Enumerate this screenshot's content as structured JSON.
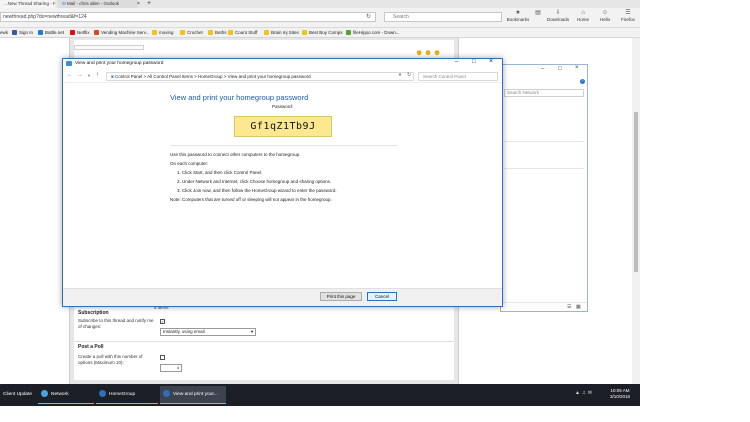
{
  "browser": {
    "tabs": [
      {
        "label": "...New Thread Sharing - Po..."
      },
      {
        "label": "Mail - chris allen - Outlook"
      }
    ],
    "new_tab_glyph": "+",
    "url": "newthread.php?do=newthread&f=124",
    "search_placeholder": "Search",
    "toolbar": [
      {
        "label": "Bookmarks",
        "icon": "star-icon"
      },
      {
        "label": "Downloads",
        "icon": "download-icon"
      },
      {
        "label": "Home",
        "icon": "home-icon"
      },
      {
        "label": "Hello",
        "icon": "chat-icon"
      },
      {
        "label": "Firefox",
        "icon": "menu-icon"
      }
    ],
    "bookmarks": [
      {
        "label": "Sign In",
        "color": "#3b5998"
      },
      {
        "label": "Battle.net",
        "color": "#1c7fd6"
      },
      {
        "label": "Netflix",
        "color": "#e50914"
      },
      {
        "label": "Vending Machine Serv...",
        "color": "#d04b2a"
      },
      {
        "label": "moving",
        "color": "#f0c419"
      },
      {
        "label": "Crochet",
        "color": "#f0c419"
      },
      {
        "label": "Beths",
        "color": "#f0c419"
      },
      {
        "label": "Count Stuff",
        "color": "#f0c419"
      },
      {
        "label": "Brain Inj Sites",
        "color": "#f0c419"
      },
      {
        "label": "Best Buy Comps",
        "color": "#f0c419"
      },
      {
        "label": "fileHippo.com - Down...",
        "color": "#5aa02c"
      }
    ]
  },
  "forum": {
    "subscription_title": "Subscription",
    "subscription_label": "Subscribe to this thread and notify me of changes:",
    "subscription_checked": true,
    "subscription_option": "Instantly, using email",
    "poll_title": "Post a Poll",
    "poll_label": "Create a poll with this number of options (Maximum 10):",
    "poll_checked": false,
    "poll_value": "4",
    "items_count": "5 items"
  },
  "background_window": {
    "search_placeholder": "Search Network"
  },
  "dialog": {
    "title": "View and print your homegroup password",
    "breadcrumb": "Control Panel  >  All Control Panel Items  >  HomeGroup  >  View and print your homegroup password",
    "search_placeholder": "Search Control Panel",
    "heading": "View and print your homegroup password",
    "password_label": "Password:",
    "password": "Gf1qZ1Tb9J",
    "intro": "Use this password to connect other computers to the homegroup.",
    "each_computer": "On each computer:",
    "steps": [
      "1. Click Start, and then click Control Panel.",
      "2. Under Network and Internet, click Choose homegroup and sharing options.",
      "3. Click Join now, and then follow the HomeGroup wizard to enter the password."
    ],
    "note": "Note: Computers that are turned off or sleeping will not appear in the homegroup.",
    "print_label": "Print this page",
    "cancel_label": "Cancel"
  },
  "taskbar": {
    "items": [
      {
        "label": "Client Update",
        "color": "#5b9bd5"
      },
      {
        "label": "Network",
        "color": "#4aa3df"
      },
      {
        "label": "HomeGroup",
        "color": "#2d6fb8"
      },
      {
        "label": "View and print your...",
        "color": "#2d6fb8"
      }
    ],
    "time": "10:06 AM",
    "date": "3/10/2016"
  }
}
